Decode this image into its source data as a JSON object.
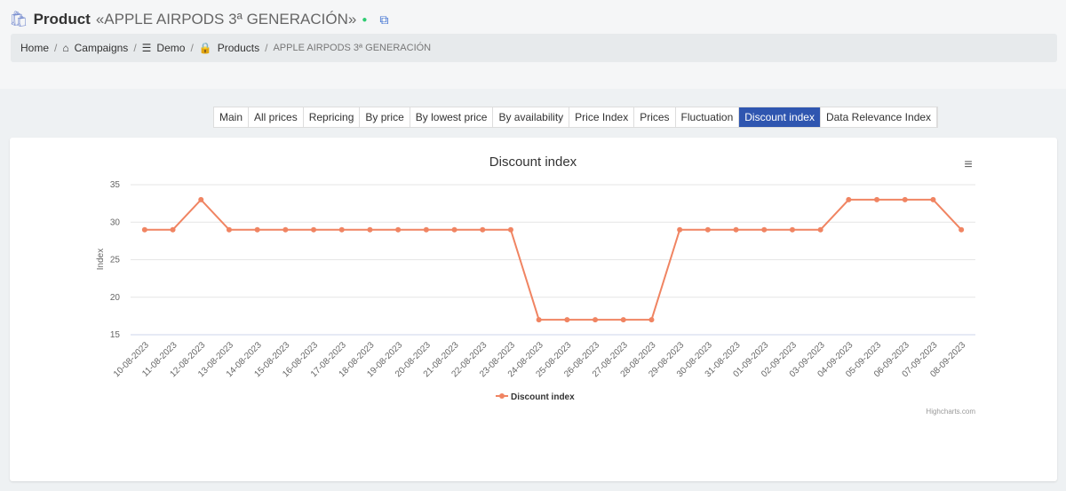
{
  "header": {
    "title": "Product",
    "product_name": "«APPLE AIRPODS 3ª GENERACIÓN»"
  },
  "breadcrumb": {
    "home": "Home",
    "campaigns": "Campaigns",
    "demo": "Demo",
    "products": "Products",
    "current": "APPLE AIRPODS 3ª GENERACIÓN"
  },
  "tabs": [
    "Main",
    "All prices",
    "Repricing",
    "By price",
    "By lowest price",
    "By availability",
    "Price Index",
    "Prices",
    "Fluctuation",
    "Discount index",
    "Data Relevance Index"
  ],
  "active_tab": 9,
  "chart_data": {
    "type": "line",
    "title": "Discount index",
    "xlabel": "",
    "ylabel": "Index",
    "ylim": [
      15,
      35
    ],
    "yticks": [
      15,
      20,
      25,
      30,
      35
    ],
    "categories": [
      "10-08-2023",
      "11-08-2023",
      "12-08-2023",
      "13-08-2023",
      "14-08-2023",
      "15-08-2023",
      "16-08-2023",
      "17-08-2023",
      "18-08-2023",
      "19-08-2023",
      "20-08-2023",
      "21-08-2023",
      "22-08-2023",
      "23-08-2023",
      "24-08-2023",
      "25-08-2023",
      "26-08-2023",
      "27-08-2023",
      "28-08-2023",
      "29-08-2023",
      "30-08-2023",
      "31-08-2023",
      "01-09-2023",
      "02-09-2023",
      "03-09-2023",
      "04-09-2023",
      "05-09-2023",
      "06-09-2023",
      "07-09-2023",
      "08-09-2023"
    ],
    "series": [
      {
        "name": "Discount index",
        "color": "#f08462",
        "values": [
          29,
          29,
          33,
          29,
          29,
          29,
          29,
          29,
          29,
          29,
          29,
          29,
          29,
          29,
          17,
          17,
          17,
          17,
          17,
          29,
          29,
          29,
          29,
          29,
          29,
          33,
          33,
          33,
          33,
          29
        ]
      }
    ],
    "legend": "bottom-center",
    "credits": "Highcharts.com"
  }
}
